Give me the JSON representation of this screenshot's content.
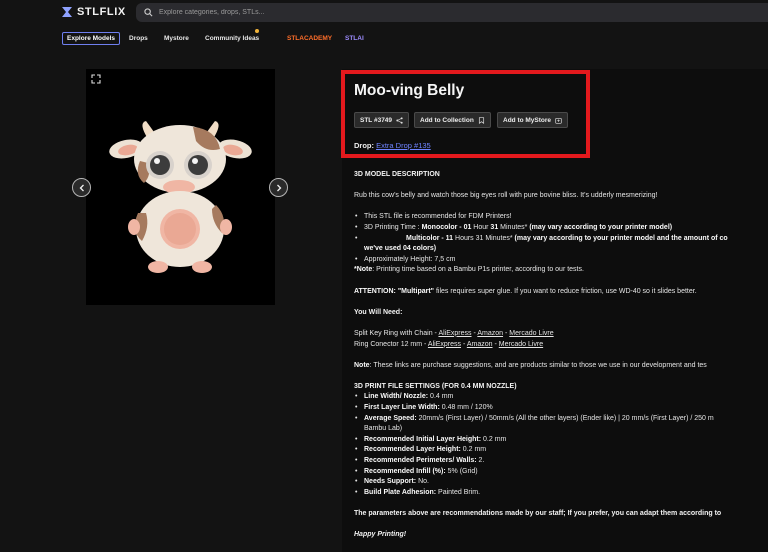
{
  "header": {
    "logo_text": "STLFLIX",
    "search_placeholder": "Explore categories, drops, STLs..."
  },
  "nav": {
    "explore": "Explore Models",
    "drops": "Drops",
    "mystore": "Mystore",
    "community": "Community Ideas",
    "academy": "STLACADEMY",
    "stlai": "STLAI"
  },
  "product": {
    "title": "Moo-ving Belly",
    "stl_id": "STL #3749",
    "add_collection": "Add to Collection",
    "add_mystore": "Add to MyStore",
    "drop_label": "Drop:",
    "drop_link": "Extra Drop #135"
  },
  "description": {
    "heading": "3D MODEL DESCRIPTION",
    "intro": "Rub this cow's belly and watch those big eyes roll with pure bovine bliss. It's udderly mesmerizing!",
    "b1": "This STL file is recommended for FDM Printers!",
    "b2_pre": "3D Printing Time : ",
    "b2_mono": "Monocolor - 01",
    "b2_hour": " Hour ",
    "b2_31": "31",
    "b2_min": " Minutes* ",
    "b2_note": "(may vary according to your printer model)",
    "multi_label": "Multicolor - 11",
    "multi_hours": " Hours 31 Minutes* ",
    "multi_note": "(may vary according to your printer model and the amount of co",
    "multi_note2": "we've used 04 colors)",
    "b3": "Approximately Height: 7,5 cm",
    "note_label": "*Note",
    "note_text": ": Printing time based on a Bambu P1s printer, according to our tests.",
    "attention_label": "ATTENTION: ",
    "attention_multipart": "\"Multipart\"",
    "attention_text": " files requires super glue. If you want to reduce friction, use WD-40 so it slides better.",
    "you_will_need": "You Will Need:",
    "item1": "Split Key Ring with Chain - ",
    "item2": "Ring Conector 12 mm - ",
    "link_ali": "AliExpress",
    "link_amazon": "Amazon",
    "link_ml": "Mercado Livre",
    "sep": " - ",
    "note2_label": "Note",
    "note2_text": ": These links are purchase suggestions, and are products similar to those we use in our development and tes",
    "settings_heading": "3D PRINT FILE SETTINGS (FOR 0.4 MM NOZZLE)",
    "settings": [
      {
        "label": "Line Width/ Nozzle:",
        "value": " 0.4 mm"
      },
      {
        "label": "First Layer Line Width:",
        "value": " 0.48 mm / 120%"
      },
      {
        "label": "Average Speed:",
        "value": " 20mm/s (First Layer) / 50mm/s (All the other layers) (Ender like) | 20 mm/s (First Layer) / 250 m"
      },
      {
        "label": "Recommended Initial Layer Height:",
        "value": "  0.2 mm"
      },
      {
        "label": "Recommended Layer Height:",
        "value": "  0.2 mm"
      },
      {
        "label": "Recommended Perimeters/ Walls:",
        "value": " 2."
      },
      {
        "label": "Recommended Infill (%):",
        "value": " 5% (Grid)"
      },
      {
        "label": "Needs Support:",
        "value": " No."
      },
      {
        "label": "Build Plate Adhesion:",
        "value": " Painted Brim."
      }
    ],
    "speed_cont": "Bambu Lab)",
    "parameters": "The parameters above are recommendations made by our staff; If you prefer, you can adapt them according to",
    "happy": "Happy Printing!"
  },
  "colors": {
    "accent_highlight": "#e3191d",
    "link": "#6f84ff",
    "academy": "#ff6e2a",
    "stlai": "#9d8cff"
  },
  "icons": [
    "stlflix-logo-icon",
    "search-icon",
    "expand-icon",
    "chevron-left-icon",
    "chevron-right-icon",
    "share-icon",
    "bookmark-icon",
    "store-icon"
  ]
}
